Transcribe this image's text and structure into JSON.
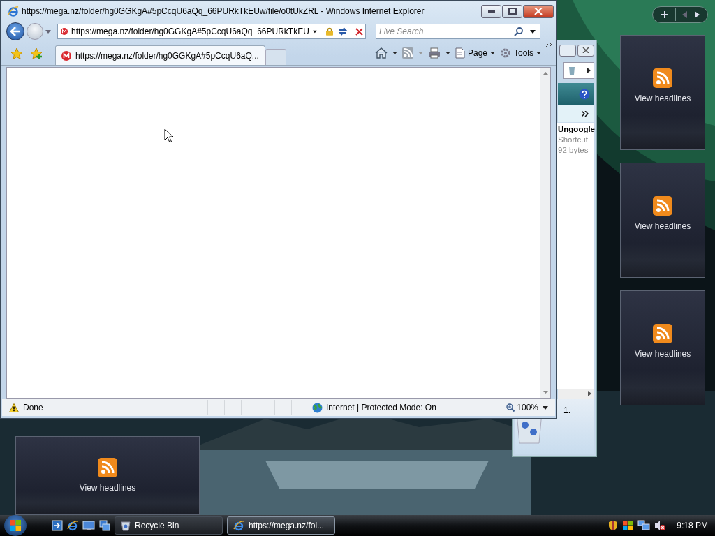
{
  "browser": {
    "title": "https://mega.nz/folder/hg0GGKgA#5pCcqU6aQq_66PURkTkEUw/file/o0tUkZRL - Windows Internet Explorer",
    "address": "https://mega.nz/folder/hg0GGKgA#5pCcqU6aQq_66PURkTkEU",
    "search_placeholder": "Live Search",
    "tabs": [
      {
        "label": "https://mega.nz/folder/hg0GGKgA#5pCcqU6aQ...",
        "selected": true
      }
    ],
    "commands": [
      "Page",
      "Tools"
    ],
    "status": "Done",
    "zone": "Internet | Protected Mode: On",
    "zoom": "100%"
  },
  "background_window": {
    "item_name": "Ungoogle",
    "item_type": "Shortcut",
    "item_size": "92 bytes",
    "preview_label": "1."
  },
  "sidebar_gadgets": [
    {
      "label": "View headlines"
    },
    {
      "label": "View headlines"
    },
    {
      "label": "View headlines"
    }
  ],
  "desktop_gadget": {
    "label": "View headlines"
  },
  "taskbar": {
    "buttons": [
      {
        "label": "Recycle Bin",
        "selected": false
      },
      {
        "label": "https://mega.nz/fol...",
        "selected": true
      }
    ],
    "clock": "9:18 PM"
  }
}
